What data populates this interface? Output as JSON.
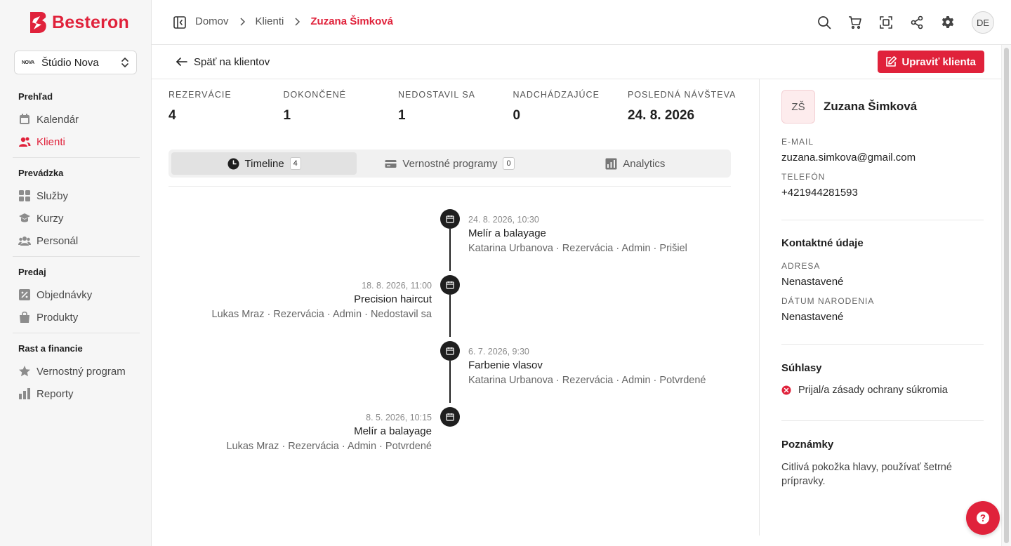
{
  "brand": {
    "name": "Besteron",
    "accent": "#e0223b"
  },
  "studio": {
    "logo": "NOVA",
    "name": "Štúdio Nova"
  },
  "sidebar": {
    "sections": [
      {
        "heading": "Prehľad",
        "items": [
          {
            "label": "Kalendár",
            "icon": "calendar-icon"
          },
          {
            "label": "Klienti",
            "icon": "users-icon",
            "active": true
          }
        ]
      },
      {
        "heading": "Prevádzka",
        "items": [
          {
            "label": "Služby",
            "icon": "grid-icon"
          },
          {
            "label": "Kurzy",
            "icon": "graduation-icon"
          },
          {
            "label": "Personál",
            "icon": "team-icon"
          }
        ]
      },
      {
        "heading": "Predaj",
        "items": [
          {
            "label": "Objednávky",
            "icon": "percent-icon"
          },
          {
            "label": "Produkty",
            "icon": "bag-icon"
          }
        ]
      },
      {
        "heading": "Rast a financie",
        "items": [
          {
            "label": "Vernostný program",
            "icon": "star-icon"
          },
          {
            "label": "Reporty",
            "icon": "bar-chart-icon"
          }
        ]
      }
    ]
  },
  "topbar": {
    "breadcrumbs": [
      "Domov",
      "Klienti",
      "Zuzana Šimková"
    ],
    "avatar_initials": "DE"
  },
  "subheader": {
    "back_label": "Späť na klientov",
    "edit_label": "Upraviť klienta"
  },
  "stats": [
    {
      "label": "REZERVÁCIE",
      "value": "4"
    },
    {
      "label": "DOKONČENÉ",
      "value": "1"
    },
    {
      "label": "NEDOSTAVIL SA",
      "value": "1"
    },
    {
      "label": "NADCHÁDZAJÚCE",
      "value": "0"
    },
    {
      "label": "POSLEDNÁ NÁVŠTEVA",
      "value": "24. 8. 2026"
    }
  ],
  "tabs": [
    {
      "label": "Timeline",
      "badge": "4",
      "icon": "clock-icon",
      "active": true
    },
    {
      "label": "Vernostné programy",
      "badge": "0",
      "icon": "card-icon"
    },
    {
      "label": "Analytics",
      "icon": "chart-icon"
    }
  ],
  "timeline": [
    {
      "date": "24. 8. 2026, 10:30",
      "title": "Melír a balayage",
      "meta": "Katarina Urbanova · Rezervácia · Admin · Prišiel",
      "side": "right"
    },
    {
      "date": "18. 8. 2026, 11:00",
      "title": "Precision haircut",
      "meta": "Lukas Mraz · Rezervácia · Admin · Nedostavil sa",
      "side": "left"
    },
    {
      "date": "6. 7. 2026, 9:30",
      "title": "Farbenie vlasov",
      "meta": "Katarina Urbanova · Rezervácia · Admin · Potvrdené",
      "side": "right"
    },
    {
      "date": "8. 5. 2026, 10:15",
      "title": "Melír a balayage",
      "meta": "Lukas Mraz · Rezervácia · Admin · Potvrdené",
      "side": "left"
    }
  ],
  "client": {
    "initials": "ZŠ",
    "name": "Zuzana Šimková",
    "email_label": "E-MAIL",
    "email": "zuzana.simkova@gmail.com",
    "phone_label": "TELEFÓN",
    "phone": "+421944281593",
    "contact_heading": "Kontaktné údaje",
    "address_label": "ADRESA",
    "address": "Nenastavené",
    "birth_label": "DÁTUM NARODENIA",
    "birth": "Nenastavené",
    "consents_heading": "Súhlasy",
    "consent_text": "Prijal/a zásady ochrany súkromia",
    "notes_heading": "Poznámky",
    "notes": "Citlivá pokožka hlavy, používať šetrné prípravky."
  }
}
